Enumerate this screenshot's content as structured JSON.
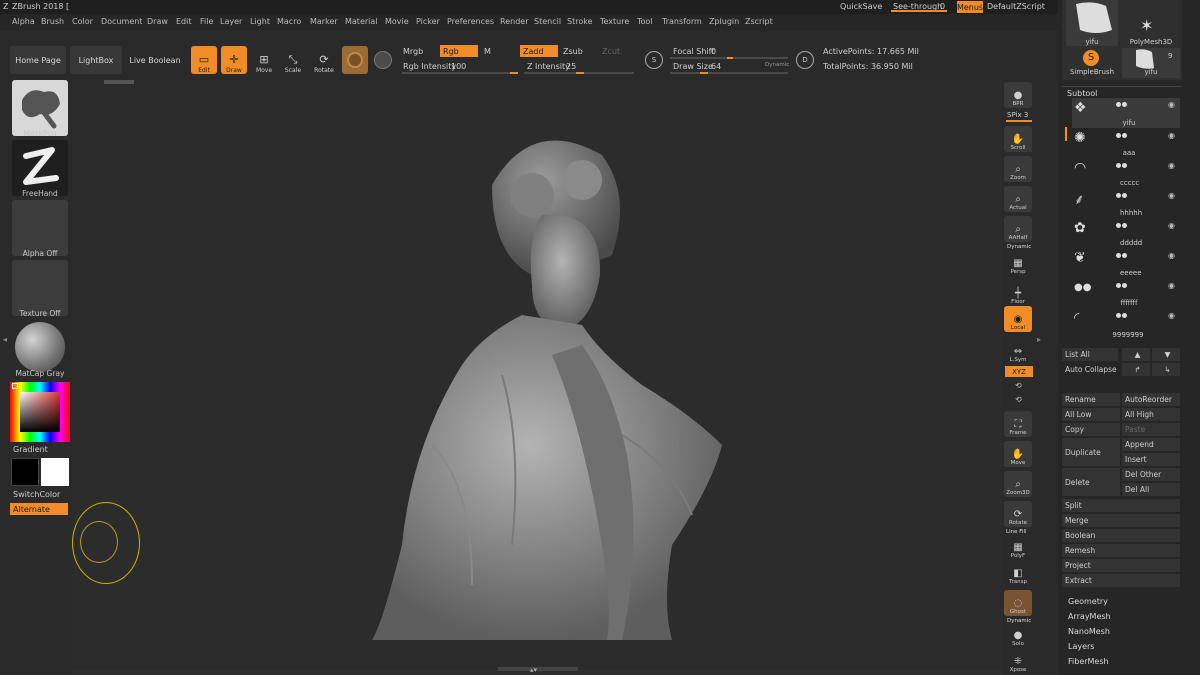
{
  "app": {
    "title": "ZBrush 2018 ["
  },
  "title_right": {
    "quicksave": "QuickSave",
    "see_through_label": "See-through",
    "see_through_value": "0",
    "menus": "Menus",
    "script": "DefaultZScript"
  },
  "menu": [
    "Alpha",
    "Brush",
    "Color",
    "Document",
    "Draw",
    "Edit",
    "File",
    "Layer",
    "Light",
    "Macro",
    "Marker",
    "Material",
    "Movie",
    "Picker",
    "Preferences",
    "Render",
    "Stencil",
    "Stroke",
    "Texture",
    "Tool",
    "Transform",
    "Zplugin",
    "Zscript"
  ],
  "shelf": {
    "home": "Home Page",
    "lightbox": "LightBox",
    "live_boolean": "Live Boolean",
    "edit": "Edit",
    "draw": "Draw",
    "move": "Move",
    "scale": "Scale",
    "rotate": "Rotate",
    "mrgb": "Mrgb",
    "rgb": "Rgb",
    "m": "M",
    "rgb_intensity_label": "Rgb Intensity",
    "rgb_intensity": "100",
    "zadd": "Zadd",
    "zsub": "Zsub",
    "zcut": "Zcut",
    "z_intensity_label": "Z Intensity",
    "z_intensity": "25",
    "focal_label": "Focal Shift",
    "focal_value": "0",
    "draw_size_label": "Draw Size",
    "draw_size": "64",
    "dynamic": "Dynamic",
    "active_points": "ActivePoints: 17.665 Mil",
    "total_points": "TotalPoints: 36.950 Mil"
  },
  "left": {
    "brush": "MaskPen",
    "stroke": "FreeHand",
    "alpha": "Alpha Off",
    "texture": "Texture Off",
    "material": "MatCap Gray",
    "gradient": "Gradient",
    "switch": "SwitchColor",
    "alternate": "Alternate"
  },
  "right_shelf": {
    "bpr": "BPR",
    "spix": "SPix 3",
    "scroll": "Scroll",
    "zoom": "Zoom",
    "actual": "Actual",
    "aahalf": "AAHalf",
    "dynamic": "Dynamic",
    "persp": "Persp",
    "floor": "Floor",
    "local": "Local",
    "lsym": "L.Sym",
    "xyz": "XYZ",
    "frame": "Frame",
    "move": "Move",
    "zoom3d": "Zoom3D",
    "rotate": "Rotate",
    "linefill": "Line Fill",
    "polyf": "PolyF",
    "transp": "Transp",
    "ghost": "Ghost",
    "dynamic2": "Dynamic",
    "solo": "Solo",
    "xpose": "Xpose"
  },
  "tool_panel": {
    "yifu": "yifu",
    "polymesh": "PolyMesh3D",
    "simplebrush": "SimpleBrush",
    "yifu2": "yifu",
    "count": "9"
  },
  "subtool": {
    "title": "Subtool",
    "items": [
      "yifu",
      "aaa",
      "ccccc",
      "hhhhh",
      "ddddd",
      "eeeee",
      "fffffff",
      "9999999"
    ]
  },
  "subtool_buttons": {
    "list_all": "List All",
    "auto_collapse": "Auto Collapse",
    "rename": "Rename",
    "autoreorder": "AutoReorder",
    "all_low": "All Low",
    "all_high": "All High",
    "copy": "Copy",
    "paste": "Paste",
    "duplicate": "Duplicate",
    "append": "Append",
    "insert": "Insert",
    "delete": "Delete",
    "del_other": "Del Other",
    "del_all": "Del All",
    "split": "Split",
    "merge": "Merge",
    "boolean": "Boolean",
    "remesh": "Remesh",
    "project": "Project",
    "extract": "Extract"
  },
  "tool_sections": [
    "Geometry",
    "ArrayMesh",
    "NanoMesh",
    "Layers",
    "FiberMesh"
  ],
  "colors": {
    "accent": "#f28c28",
    "bg": "#2c2c2c",
    "panel": "#262626"
  }
}
